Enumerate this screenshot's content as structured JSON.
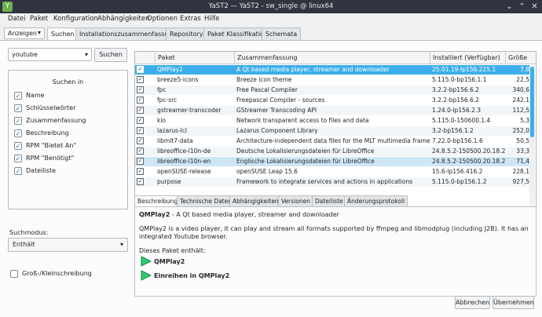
{
  "window": {
    "title": "YaST2 — YaST2 - sw_single @ linux64",
    "app_icon": "yast-icon",
    "controls": [
      "minimize-icon",
      "maximize-icon",
      "close-icon"
    ]
  },
  "menubar": {
    "items": [
      "Datei",
      "Paket",
      "Konfiguration",
      "Abhängigkeiten",
      "Optionen",
      "Extras",
      "Hilfe"
    ]
  },
  "view_selector": {
    "label": "Anzeigen"
  },
  "tabs": [
    "Suchen",
    "Installationszusammenfassung",
    "Repositorys",
    "Paket Klassifikation",
    "Schemata"
  ],
  "search": {
    "query": "youtube",
    "button": "Suchen"
  },
  "search_in": {
    "title": "Suchen in",
    "options": [
      {
        "label": "Name",
        "checked": true
      },
      {
        "label": "Schlüsselwörter",
        "checked": true
      },
      {
        "label": "Zusammenfassung",
        "checked": true
      },
      {
        "label": "Beschreibung",
        "checked": true
      },
      {
        "label": "RPM \"Bietet An\"",
        "checked": true
      },
      {
        "label": "RPM \"Benötigt\"",
        "checked": true
      },
      {
        "label": "Dateiliste",
        "checked": true
      }
    ]
  },
  "search_mode": {
    "label": "Suchmodus:",
    "value": "Enthält"
  },
  "case_sensitive": {
    "label": "Groß-/Kleinschreibung",
    "checked": false
  },
  "package_table": {
    "columns": [
      "Paket",
      "Zusammenfassung",
      "Installiert (Verfügbar)",
      "Größe"
    ],
    "rows": [
      {
        "name": "QMPlay2",
        "summary": "A Qt based media player, streamer and downloader",
        "installed": "25.01.19-lp156.225.1",
        "size": "7,8",
        "checked": true,
        "selected": true
      },
      {
        "name": "breeze5-icons",
        "summary": "Breeze icon theme",
        "installed": "5.115.0-bp156.1.1",
        "size": "22,5",
        "checked": true
      },
      {
        "name": "fpc",
        "summary": "Free Pascal Compiler",
        "installed": "3.2.2-bp156.6.2",
        "size": "340,6",
        "checked": true
      },
      {
        "name": "fpc-src",
        "summary": "Freepascal Compiler - sources",
        "installed": "3.2.2-bp156.6.2",
        "size": "242,1",
        "checked": true
      },
      {
        "name": "gstreamer-transcoder",
        "summary": "GStreamer Transcoding API",
        "installed": "1.24.0-lp156.2.3",
        "size": "112,5",
        "checked": true
      },
      {
        "name": "kio",
        "summary": "Network transparent access to files and data",
        "installed": "5.115.0-150600.1.4",
        "size": "5,3",
        "checked": true
      },
      {
        "name": "lazarus-lcl",
        "summary": "Lazarus Component Library",
        "installed": "3.2-bp156.1.2",
        "size": "252,0",
        "checked": true
      },
      {
        "name": "libmlt7-data",
        "summary": "Architecture-independent data files for the MLT multimedia framework",
        "installed": "7.22.0-bp156.1.6",
        "size": "50,5",
        "checked": true
      },
      {
        "name": "libreoffice-l10n-de",
        "summary": "Deutsche Lokalisierungsdateien für LibreOffice",
        "installed": "24.8.5.2-150500.20.18.2",
        "size": "33,3",
        "checked": true
      },
      {
        "name": "libreoffice-l10n-en",
        "summary": "Englische Lokalisierungsdateien für LibreOffice",
        "installed": "24.8.5.2-150500.20.18.2",
        "size": "71,4",
        "checked": true
      },
      {
        "name": "openSUSE-release",
        "summary": "openSUSE Leap 15.6",
        "installed": "15.6-lp156.416.2",
        "size": "228,1",
        "checked": true
      },
      {
        "name": "purpose",
        "summary": "Framework to integrate services and actions in applications",
        "installed": "5.115.0-bp156.1.2",
        "size": "927,5",
        "checked": true
      }
    ]
  },
  "detail_tabs": [
    "Beschreibung",
    "Technische Daten",
    "Abhängigkeiten",
    "Versionen",
    "Dateiliste",
    "Änderungsprotokoll"
  ],
  "details": {
    "package": "QMPlay2",
    "summary": " - A Qt based media player, streamer and downloader",
    "description": "QMPlay2 is a video player, it can play and stream all formats supported by ffmpeg and libmodplug (including J2B). It has an integrated Youtube browser.",
    "contains_label": "Dieses Paket enthält:",
    "contains": [
      "QMPlay2",
      "Einreihen in QMPlay2"
    ]
  },
  "buttons": {
    "cancel": "Abbrechen",
    "accept": "Übernehmen"
  },
  "colors": {
    "selection": "#3daee9",
    "titlebar": "#2f343f",
    "play_icon": "#2ecc71"
  }
}
